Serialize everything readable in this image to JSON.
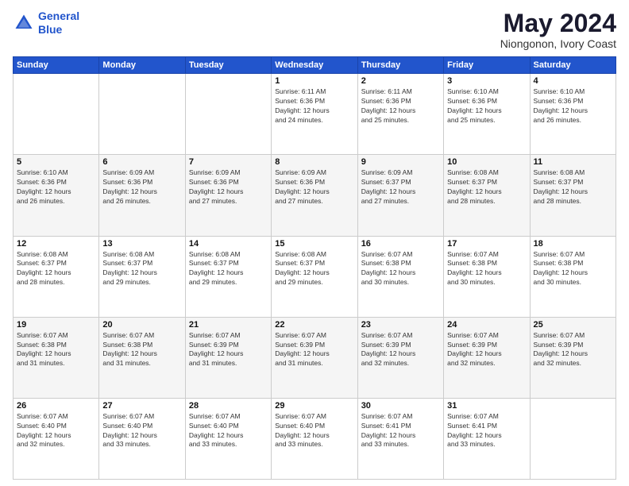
{
  "logo": {
    "line1": "General",
    "line2": "Blue"
  },
  "title": "May 2024",
  "subtitle": "Niongonon, Ivory Coast",
  "weekdays": [
    "Sunday",
    "Monday",
    "Tuesday",
    "Wednesday",
    "Thursday",
    "Friday",
    "Saturday"
  ],
  "weeks": [
    [
      {
        "day": "",
        "info": ""
      },
      {
        "day": "",
        "info": ""
      },
      {
        "day": "",
        "info": ""
      },
      {
        "day": "1",
        "info": "Sunrise: 6:11 AM\nSunset: 6:36 PM\nDaylight: 12 hours\nand 24 minutes."
      },
      {
        "day": "2",
        "info": "Sunrise: 6:11 AM\nSunset: 6:36 PM\nDaylight: 12 hours\nand 25 minutes."
      },
      {
        "day": "3",
        "info": "Sunrise: 6:10 AM\nSunset: 6:36 PM\nDaylight: 12 hours\nand 25 minutes."
      },
      {
        "day": "4",
        "info": "Sunrise: 6:10 AM\nSunset: 6:36 PM\nDaylight: 12 hours\nand 26 minutes."
      }
    ],
    [
      {
        "day": "5",
        "info": "Sunrise: 6:10 AM\nSunset: 6:36 PM\nDaylight: 12 hours\nand 26 minutes."
      },
      {
        "day": "6",
        "info": "Sunrise: 6:09 AM\nSunset: 6:36 PM\nDaylight: 12 hours\nand 26 minutes."
      },
      {
        "day": "7",
        "info": "Sunrise: 6:09 AM\nSunset: 6:36 PM\nDaylight: 12 hours\nand 27 minutes."
      },
      {
        "day": "8",
        "info": "Sunrise: 6:09 AM\nSunset: 6:36 PM\nDaylight: 12 hours\nand 27 minutes."
      },
      {
        "day": "9",
        "info": "Sunrise: 6:09 AM\nSunset: 6:37 PM\nDaylight: 12 hours\nand 27 minutes."
      },
      {
        "day": "10",
        "info": "Sunrise: 6:08 AM\nSunset: 6:37 PM\nDaylight: 12 hours\nand 28 minutes."
      },
      {
        "day": "11",
        "info": "Sunrise: 6:08 AM\nSunset: 6:37 PM\nDaylight: 12 hours\nand 28 minutes."
      }
    ],
    [
      {
        "day": "12",
        "info": "Sunrise: 6:08 AM\nSunset: 6:37 PM\nDaylight: 12 hours\nand 28 minutes."
      },
      {
        "day": "13",
        "info": "Sunrise: 6:08 AM\nSunset: 6:37 PM\nDaylight: 12 hours\nand 29 minutes."
      },
      {
        "day": "14",
        "info": "Sunrise: 6:08 AM\nSunset: 6:37 PM\nDaylight: 12 hours\nand 29 minutes."
      },
      {
        "day": "15",
        "info": "Sunrise: 6:08 AM\nSunset: 6:37 PM\nDaylight: 12 hours\nand 29 minutes."
      },
      {
        "day": "16",
        "info": "Sunrise: 6:07 AM\nSunset: 6:38 PM\nDaylight: 12 hours\nand 30 minutes."
      },
      {
        "day": "17",
        "info": "Sunrise: 6:07 AM\nSunset: 6:38 PM\nDaylight: 12 hours\nand 30 minutes."
      },
      {
        "day": "18",
        "info": "Sunrise: 6:07 AM\nSunset: 6:38 PM\nDaylight: 12 hours\nand 30 minutes."
      }
    ],
    [
      {
        "day": "19",
        "info": "Sunrise: 6:07 AM\nSunset: 6:38 PM\nDaylight: 12 hours\nand 31 minutes."
      },
      {
        "day": "20",
        "info": "Sunrise: 6:07 AM\nSunset: 6:38 PM\nDaylight: 12 hours\nand 31 minutes."
      },
      {
        "day": "21",
        "info": "Sunrise: 6:07 AM\nSunset: 6:39 PM\nDaylight: 12 hours\nand 31 minutes."
      },
      {
        "day": "22",
        "info": "Sunrise: 6:07 AM\nSunset: 6:39 PM\nDaylight: 12 hours\nand 31 minutes."
      },
      {
        "day": "23",
        "info": "Sunrise: 6:07 AM\nSunset: 6:39 PM\nDaylight: 12 hours\nand 32 minutes."
      },
      {
        "day": "24",
        "info": "Sunrise: 6:07 AM\nSunset: 6:39 PM\nDaylight: 12 hours\nand 32 minutes."
      },
      {
        "day": "25",
        "info": "Sunrise: 6:07 AM\nSunset: 6:39 PM\nDaylight: 12 hours\nand 32 minutes."
      }
    ],
    [
      {
        "day": "26",
        "info": "Sunrise: 6:07 AM\nSunset: 6:40 PM\nDaylight: 12 hours\nand 32 minutes."
      },
      {
        "day": "27",
        "info": "Sunrise: 6:07 AM\nSunset: 6:40 PM\nDaylight: 12 hours\nand 33 minutes."
      },
      {
        "day": "28",
        "info": "Sunrise: 6:07 AM\nSunset: 6:40 PM\nDaylight: 12 hours\nand 33 minutes."
      },
      {
        "day": "29",
        "info": "Sunrise: 6:07 AM\nSunset: 6:40 PM\nDaylight: 12 hours\nand 33 minutes."
      },
      {
        "day": "30",
        "info": "Sunrise: 6:07 AM\nSunset: 6:41 PM\nDaylight: 12 hours\nand 33 minutes."
      },
      {
        "day": "31",
        "info": "Sunrise: 6:07 AM\nSunset: 6:41 PM\nDaylight: 12 hours\nand 33 minutes."
      },
      {
        "day": "",
        "info": ""
      }
    ]
  ]
}
